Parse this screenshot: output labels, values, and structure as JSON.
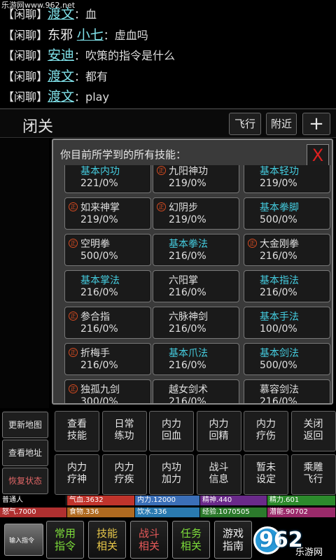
{
  "watermark": "乐游网www.962.net",
  "chat": [
    {
      "ch": "【闲聊】",
      "prefix": "",
      "name": "渡文",
      "msg": "：血"
    },
    {
      "ch": "【闲聊】",
      "prefix": "东邪 ",
      "name": "小七",
      "msg": "：虚血吗"
    },
    {
      "ch": "【闲聊】",
      "prefix": "",
      "name": "安迪",
      "msg": "：吹策的指令是什么"
    },
    {
      "ch": "【闲聊】",
      "prefix": "",
      "name": "渡文",
      "msg": "：都有"
    },
    {
      "ch": "【闲聊】",
      "prefix": "",
      "name": "渡文",
      "msg": "：play"
    }
  ],
  "location": {
    "title": "闭关",
    "fly": "飞行",
    "nearby": "附近",
    "plus": "+"
  },
  "dialog": {
    "header": "你目前所学到的所有技能：",
    "close": "X",
    "badge": "正"
  },
  "skills": [
    {
      "name": "基本内功",
      "value": "221/0%",
      "basic": true,
      "badge": false
    },
    {
      "name": "九阳神功",
      "value": "219/0%",
      "basic": false,
      "badge": true
    },
    {
      "name": "基本轻功",
      "value": "219/0%",
      "basic": true,
      "badge": false
    },
    {
      "name": "如来神掌",
      "value": "219/0%",
      "basic": false,
      "badge": true
    },
    {
      "name": "幻阴步",
      "value": "219/0%",
      "basic": false,
      "badge": true
    },
    {
      "name": "基本拳脚",
      "value": "500/0%",
      "basic": true,
      "badge": false
    },
    {
      "name": "空明拳",
      "value": "500/0%",
      "basic": false,
      "badge": true
    },
    {
      "name": "基本拳法",
      "value": "216/0%",
      "basic": true,
      "badge": false
    },
    {
      "name": "大金刚拳",
      "value": "216/0%",
      "basic": false,
      "badge": true
    },
    {
      "name": "基本掌法",
      "value": "216/0%",
      "basic": true,
      "badge": false
    },
    {
      "name": "六阳掌",
      "value": "216/0%",
      "basic": false,
      "badge": false
    },
    {
      "name": "基本指法",
      "value": "216/0%",
      "basic": true,
      "badge": false
    },
    {
      "name": "参合指",
      "value": "216/0%",
      "basic": false,
      "badge": true
    },
    {
      "name": "六脉神剑",
      "value": "216/0%",
      "basic": false,
      "badge": false
    },
    {
      "name": "基本手法",
      "value": "100/0%",
      "basic": true,
      "badge": false
    },
    {
      "name": "折梅手",
      "value": "216/0%",
      "basic": false,
      "badge": true
    },
    {
      "name": "基本爪法",
      "value": "216/0%",
      "basic": true,
      "badge": false
    },
    {
      "name": "基本剑法",
      "value": "500/0%",
      "basic": true,
      "badge": false
    },
    {
      "name": "独孤九剑",
      "value": "300/0%",
      "basic": false,
      "badge": true
    },
    {
      "name": "越女剑术",
      "value": "216/0%",
      "basic": false,
      "badge": false
    },
    {
      "name": "慕容剑法",
      "value": "216/0%",
      "basic": false,
      "badge": false
    }
  ],
  "side": {
    "update_map": "更新地图",
    "view_address": "查看地址",
    "restore": "恢复状态"
  },
  "actions": [
    {
      "l1": "查看",
      "l2": "技能"
    },
    {
      "l1": "日常",
      "l2": "练功"
    },
    {
      "l1": "内力",
      "l2": "回血"
    },
    {
      "l1": "内力",
      "l2": "回精"
    },
    {
      "l1": "内力",
      "l2": "疗伤"
    },
    {
      "l1": "关闭",
      "l2": "返回"
    },
    {
      "l1": "内力",
      "l2": "疗神"
    },
    {
      "l1": "内力",
      "l2": "疗疾"
    },
    {
      "l1": "内功",
      "l2": "加力"
    },
    {
      "l1": "战斗",
      "l2": "信息"
    },
    {
      "l1": "暂未",
      "l2": "设定"
    },
    {
      "l1": "乘雕",
      "l2": "飞行"
    }
  ],
  "stats": [
    {
      "text": "普通人",
      "color": "#000000"
    },
    {
      "text": "气血.3632",
      "color": "#c0342c"
    },
    {
      "text": "内力.12000",
      "color": "#3b6fb8"
    },
    {
      "text": "精神.440",
      "color": "#6a2a8a"
    },
    {
      "text": "精力.601",
      "color": "#2c8a2c"
    },
    {
      "text": "怒气.7000",
      "color": "#b03030"
    },
    {
      "text": "食物.336",
      "color": "#b06a20"
    },
    {
      "text": "饮水.336",
      "color": "#2a7ab0"
    },
    {
      "text": "经验.1070505",
      "color": "#2c7a2c"
    },
    {
      "text": "潜能.90702",
      "color": "#9a2a6a"
    }
  ],
  "bottom": {
    "input": "输入指令",
    "buttons": [
      {
        "l1": "常用",
        "l2": "指令"
      },
      {
        "l1": "技能",
        "l2": "相关"
      },
      {
        "l1": "战斗",
        "l2": "相关"
      },
      {
        "l1": "任务",
        "l2": "相关"
      },
      {
        "l1": "游戏",
        "l2": "指南"
      }
    ],
    "logo": "962",
    "logo_sub": "乐游网"
  }
}
